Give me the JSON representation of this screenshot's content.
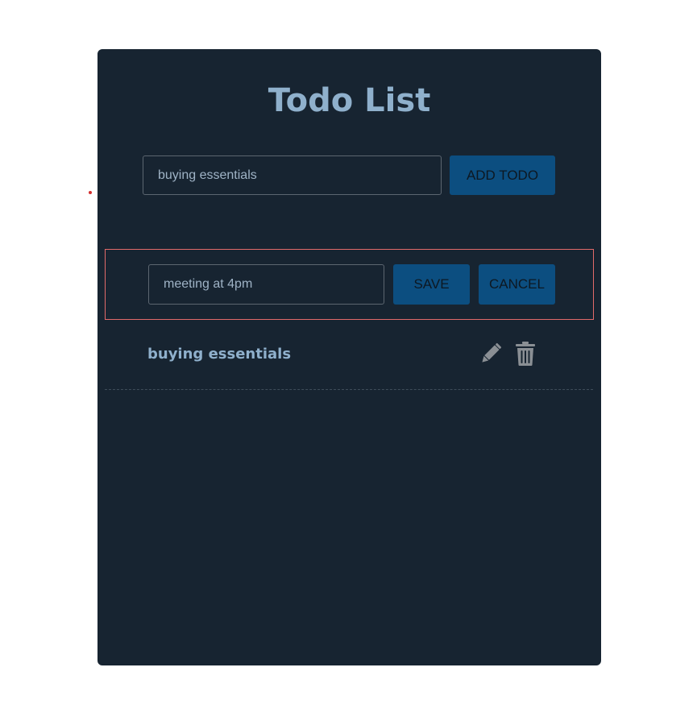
{
  "app": {
    "title": "Todo List"
  },
  "new_todo": {
    "input_value": "buying essentials",
    "add_button_label": "ADD TODO"
  },
  "editing": {
    "input_value": "meeting at 4pm",
    "save_label": "SAVE",
    "cancel_label": "CANCEL"
  },
  "todos": [
    {
      "text": "buying essentials",
      "edit_icon": "pencil-icon",
      "delete_icon": "trash-icon"
    }
  ],
  "colors": {
    "panel_bg": "#172431",
    "accent_button": "#0c4e80",
    "title_text": "#8fb0cc",
    "edit_outline": "#e26a6a",
    "icon": "#8a8f94"
  }
}
